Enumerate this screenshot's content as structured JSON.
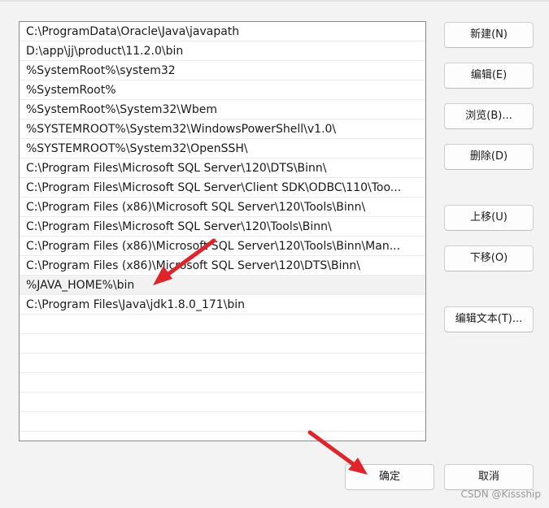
{
  "path_entries": [
    "C:\\ProgramData\\Oracle\\Java\\javapath",
    "D:\\app\\jj\\product\\11.2.0\\bin",
    "%SystemRoot%\\system32",
    "%SystemRoot%",
    "%SystemRoot%\\System32\\Wbem",
    "%SYSTEMROOT%\\System32\\WindowsPowerShell\\v1.0\\",
    "%SYSTEMROOT%\\System32\\OpenSSH\\",
    "C:\\Program Files\\Microsoft SQL Server\\120\\DTS\\Binn\\",
    "C:\\Program Files\\Microsoft SQL Server\\Client SDK\\ODBC\\110\\Too...",
    "C:\\Program Files (x86)\\Microsoft SQL Server\\120\\Tools\\Binn\\",
    "C:\\Program Files\\Microsoft SQL Server\\120\\Tools\\Binn\\",
    "C:\\Program Files (x86)\\Microsoft SQL Server\\120\\Tools\\Binn\\Man...",
    "C:\\Program Files (x86)\\Microsoft SQL Server\\120\\DTS\\Binn\\",
    "%JAVA_HOME%\\bin",
    "C:\\Program Files\\Java\\jdk1.8.0_171\\bin",
    "",
    "",
    "",
    "",
    "",
    "",
    ""
  ],
  "selected_entry_index": 13,
  "buttons": {
    "new": "新建(N)",
    "edit": "编辑(E)",
    "browse": "浏览(B)...",
    "delete": "删除(D)",
    "move_up": "上移(U)",
    "move_down": "下移(O)",
    "edit_text": "编辑文本(T)...",
    "ok": "确定",
    "cancel": "取消"
  },
  "watermark": "CSDN @Kissship",
  "colors": {
    "annotation_arrow": "#e0242c",
    "selection_background": "#f2f2f2"
  }
}
